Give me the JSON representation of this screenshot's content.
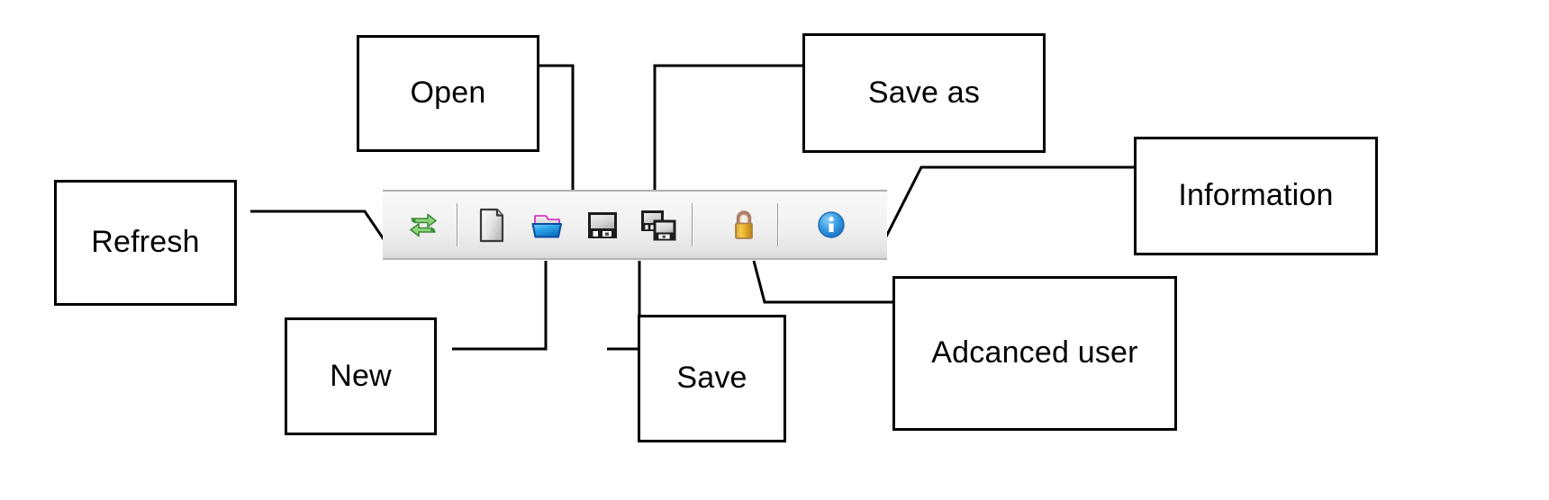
{
  "diagram": {
    "title": "Toolbar buttons annotated diagram",
    "line_color": "#000000",
    "box_border_color": "#000000",
    "background": "#ffffff"
  },
  "callouts": [
    {
      "id": "refresh",
      "label": "Refresh"
    },
    {
      "id": "open",
      "label": "Open"
    },
    {
      "id": "save-as",
      "label": "Save as"
    },
    {
      "id": "information",
      "label": "Information"
    },
    {
      "id": "new",
      "label": "New"
    },
    {
      "id": "save",
      "label": "Save"
    },
    {
      "id": "advanced-user",
      "label": "Adcanced user"
    }
  ],
  "toolbar": {
    "background_top": "#f7f7f7",
    "background_bottom": "#d8d8d8",
    "separator_color": "#9a9a9a",
    "buttons": [
      {
        "id": "refresh",
        "icon": "refresh-icon",
        "tooltip": "Refresh",
        "color": "#7fc66b"
      },
      {
        "id": "new",
        "icon": "new-document-icon",
        "tooltip": "New",
        "color": "#d6d6d6"
      },
      {
        "id": "open",
        "icon": "open-folder-icon",
        "tooltip": "Open",
        "color": "#1e9ee5"
      },
      {
        "id": "save",
        "icon": "save-floppy-icon",
        "tooltip": "Save",
        "color": "#2b2b2b"
      },
      {
        "id": "save-as",
        "icon": "save-as-icon",
        "tooltip": "Save as",
        "color": "#2b2b2b"
      },
      {
        "id": "advanced-user",
        "icon": "lock-icon",
        "tooltip": "Adcanced user",
        "color": "#e8b11e"
      },
      {
        "id": "information",
        "icon": "info-icon",
        "tooltip": "Information",
        "color": "#2a8fe0"
      }
    ]
  }
}
